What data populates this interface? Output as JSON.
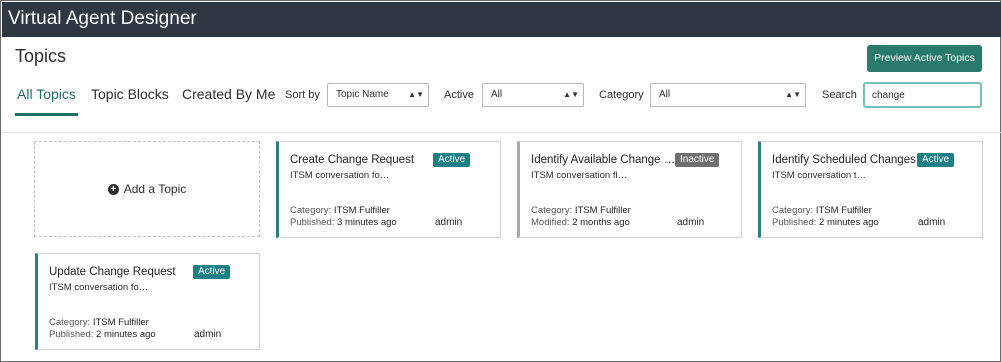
{
  "app": {
    "title": "Virtual Agent Designer"
  },
  "page": {
    "title": "Topics",
    "preview_button": "Preview Active Topics"
  },
  "tabs": [
    {
      "label": "All Topics"
    },
    {
      "label": "Topic Blocks"
    },
    {
      "label": "Created By Me"
    }
  ],
  "filters": {
    "sort_label": "Sort by",
    "sort_value": "Topic Name",
    "active_label": "Active",
    "active_value": "All",
    "category_label": "Category",
    "category_value": "All",
    "search_label": "Search",
    "search_value": "change"
  },
  "add_topic_label": "Add a Topic",
  "cards": [
    {
      "title": "Create Change Request",
      "status": "Active",
      "description": "ITSM conversation fo…",
      "category_key": "Category:",
      "category": "ITSM Fulfiller",
      "time_key": "Published:",
      "time": "3 minutes ago",
      "author": "admin"
    },
    {
      "title": "Identify Available Change …",
      "status": "Inactive",
      "description": "ITSM conversation fl…",
      "category_key": "Category:",
      "category": "ITSM Fulfiller",
      "time_key": "Modified:",
      "time": "2 months ago",
      "author": "admin"
    },
    {
      "title": "Identify Scheduled Changes",
      "status": "Active",
      "description": "ITSM conversation t…",
      "category_key": "Category:",
      "category": "ITSM Fulfiller",
      "time_key": "Published:",
      "time": "2 minutes ago",
      "author": "admin"
    },
    {
      "title": "Update Change Request",
      "status": "Active",
      "description": "ITSM conversation fo…",
      "category_key": "Category:",
      "category": "ITSM Fulfiller",
      "time_key": "Published:",
      "time": "2 minutes ago",
      "author": "admin"
    }
  ],
  "colors": {
    "header_bg": "#2f3742",
    "accent": "#2a7a6c",
    "active_badge": "#1e7f86",
    "inactive_badge": "#6f6f6f"
  }
}
